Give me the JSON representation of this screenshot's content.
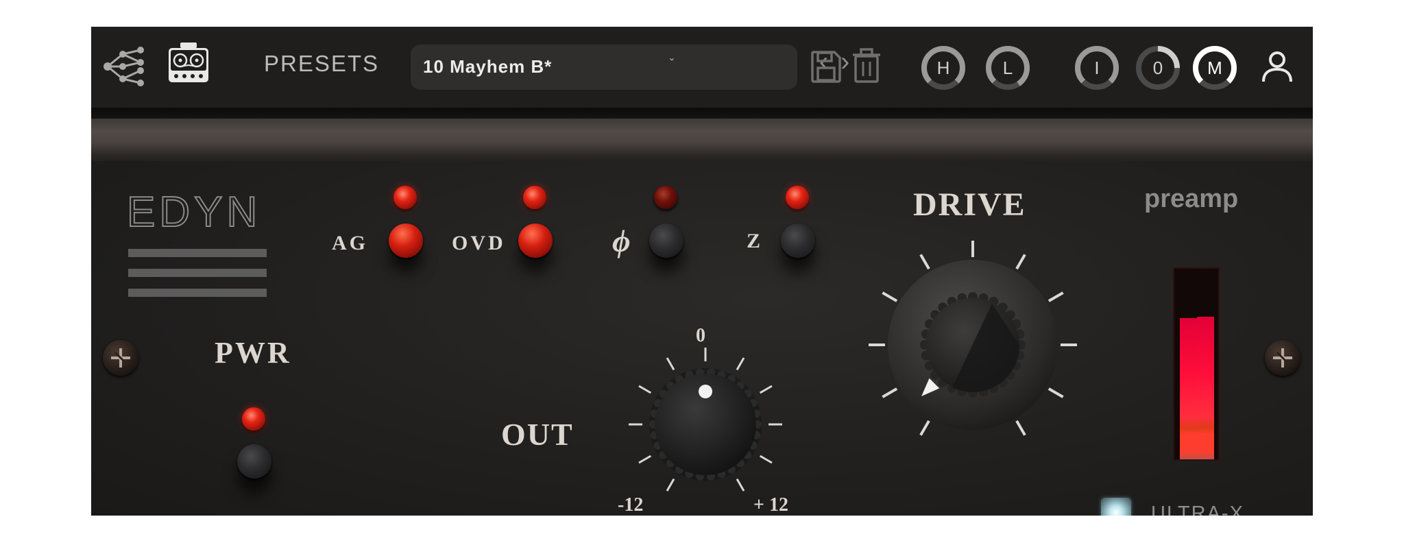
{
  "header": {
    "presets_label": "PRESETS",
    "preset_name": "10 Mayhem B*",
    "dropdown_glyph": "ˇ",
    "prev_glyph": "‹",
    "next_glyph": "›",
    "toggles": [
      {
        "letter": "H",
        "level": 0.75
      },
      {
        "letter": "L",
        "level": 0.78
      },
      {
        "letter": "I",
        "level": 0.75
      },
      {
        "letter": "0",
        "level": 0.25
      },
      {
        "letter": "M",
        "level": 0.75
      }
    ],
    "icons": [
      "routing-icon",
      "tape-recorder-icon",
      "save-icon",
      "trash-icon",
      "user-icon"
    ]
  },
  "panel": {
    "brand": "EDYN",
    "preamp_label": "preamp",
    "switches": [
      {
        "label": "AG",
        "led_on": true,
        "button_on": true
      },
      {
        "label": "OVD",
        "led_on": true,
        "button_on": true
      },
      {
        "label": "ϕ",
        "led_on": false,
        "button_on": false
      },
      {
        "label": "Z",
        "led_on": true,
        "button_on": false
      }
    ],
    "power": {
      "label": "PWR",
      "led_on": true
    },
    "out": {
      "label": "OUT",
      "scale_top": "0",
      "scale_min": "-12",
      "scale_max": "+ 12",
      "value_db": 0
    },
    "drive": {
      "label": "DRIVE",
      "position": 0.05
    },
    "ultra": {
      "label": "ULTRA-X",
      "on": true
    },
    "meter": {
      "left": 0.74,
      "right": 0.75
    }
  },
  "colors": {
    "accent_red": "#e52414",
    "panel": "#1c1b1a",
    "label": "#dcd6cf"
  }
}
